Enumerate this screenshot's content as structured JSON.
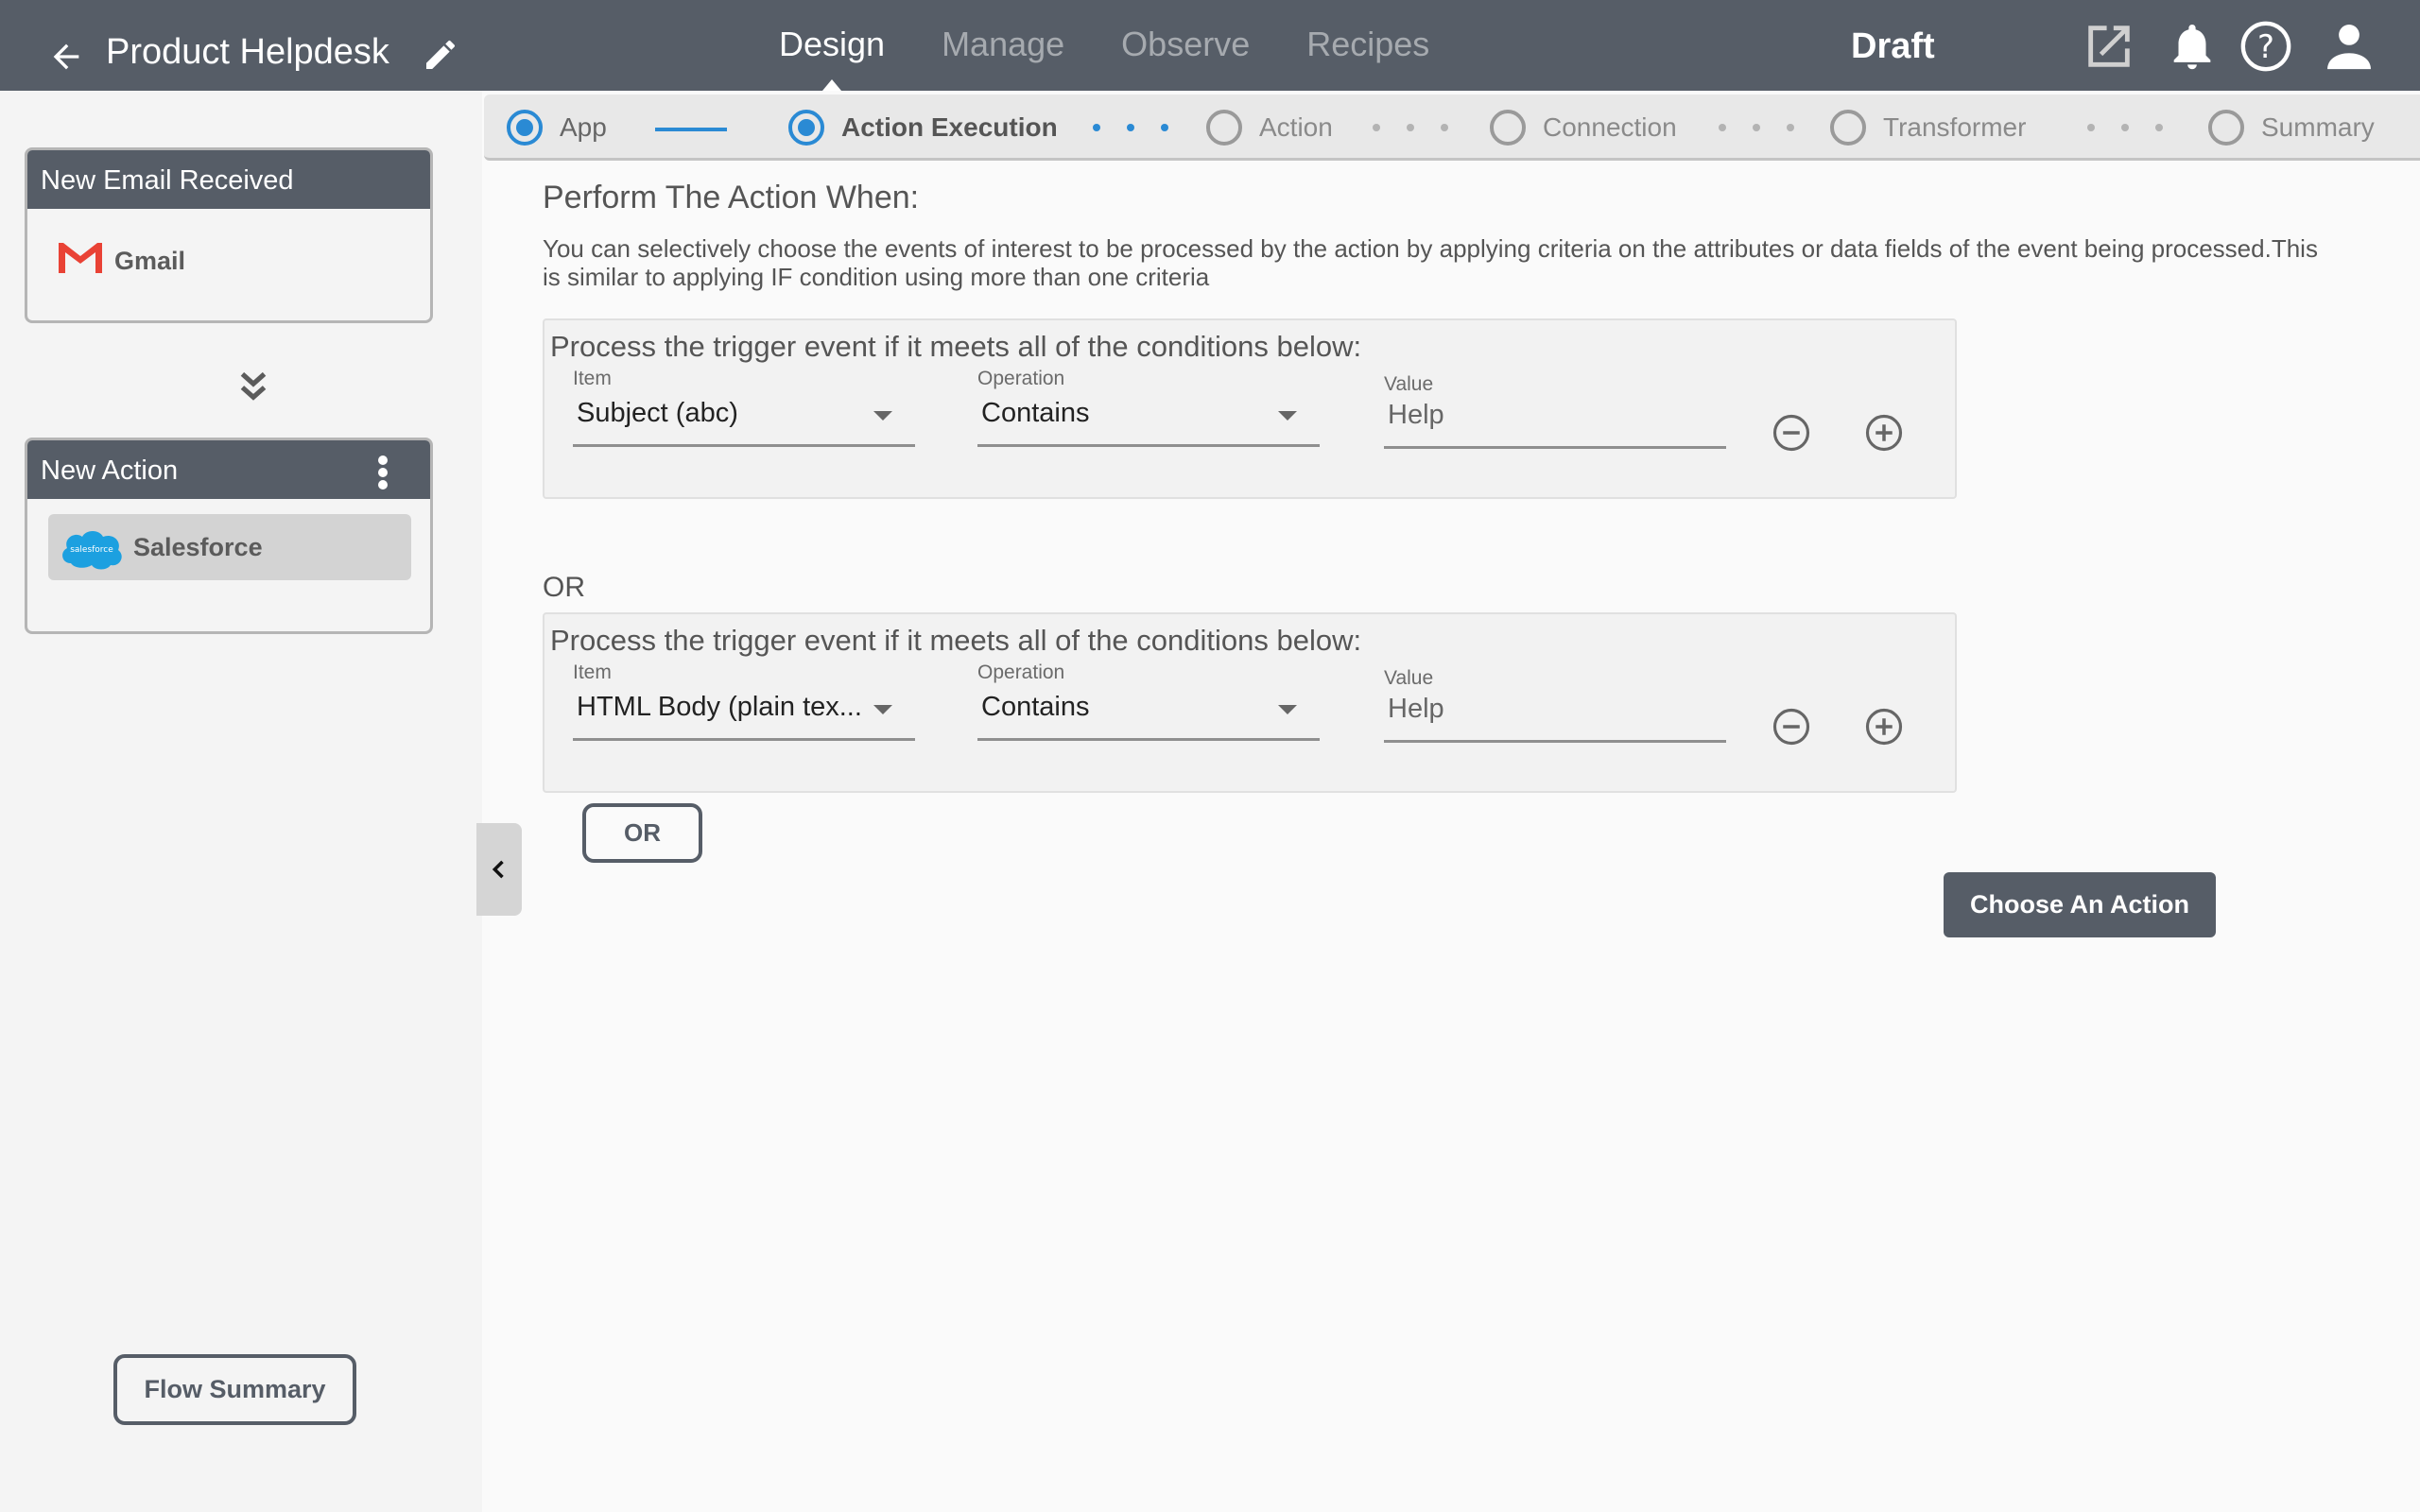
{
  "header": {
    "back_icon": "arrow-left-icon",
    "title": "Product Helpdesk",
    "edit_icon": "pencil-icon",
    "nav": [
      {
        "label": "Design",
        "active": true
      },
      {
        "label": "Manage",
        "active": false
      },
      {
        "label": "Observe",
        "active": false
      },
      {
        "label": "Recipes",
        "active": false
      }
    ],
    "status": "Draft",
    "icons": [
      "open-in-new-icon",
      "bell-icon",
      "help-icon",
      "user-icon"
    ]
  },
  "sidebar": {
    "trigger_card": {
      "title": "New Email Received",
      "app": "Gmail",
      "app_icon": "gmail-icon"
    },
    "connector_icon": "double-chevron-down-icon",
    "action_card": {
      "title": "New Action",
      "app": "Salesforce",
      "app_icon": "salesforce-icon",
      "menu_icon": "kebab-icon"
    },
    "flow_summary_label": "Flow Summary",
    "collapse_icon": "chevron-left-icon"
  },
  "stepper": {
    "steps": [
      {
        "label": "App",
        "state": "done"
      },
      {
        "label": "Action Execution",
        "state": "current"
      },
      {
        "label": "Action",
        "state": "pending"
      },
      {
        "label": "Connection",
        "state": "pending"
      },
      {
        "label": "Transformer",
        "state": "pending"
      },
      {
        "label": "Summary",
        "state": "pending"
      }
    ],
    "accent_color": "#2a8ad4"
  },
  "main": {
    "title": "Perform The Action When:",
    "description": "You can selectively choose the events of interest to be processed by the action by applying criteria on the attributes or data fields of the event being processed.This is similar to applying IF condition using more than one criteria",
    "groups": [
      {
        "title": "Process the trigger event if it meets all of the conditions below:",
        "item_label": "Item",
        "item_value": "Subject (abc)",
        "operation_label": "Operation",
        "operation_value": "Contains",
        "value_label": "Value",
        "value": "Help"
      },
      {
        "title": "Process the trigger event if it meets all of the conditions below:",
        "item_label": "Item",
        "item_value": "HTML Body (plain tex...",
        "operation_label": "Operation",
        "operation_value": "Contains",
        "value_label": "Value",
        "value": "Help"
      }
    ],
    "or_separator": "OR",
    "or_button_label": "OR",
    "primary_button_label": "Choose An Action"
  }
}
